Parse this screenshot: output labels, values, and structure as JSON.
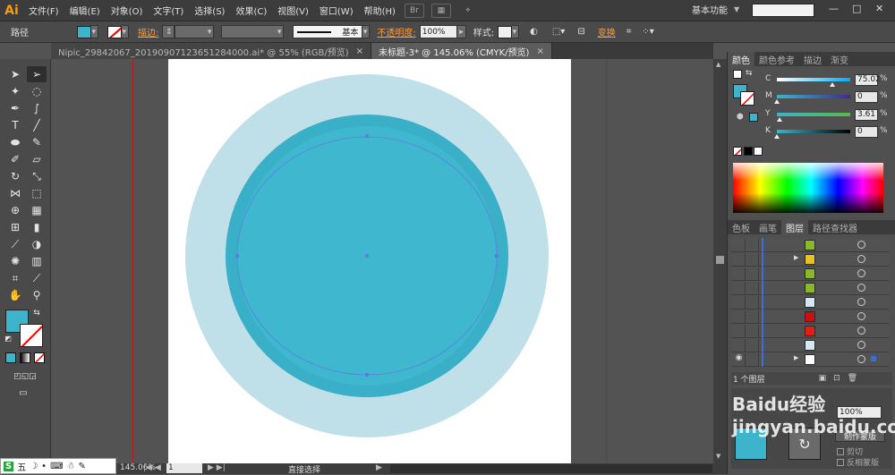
{
  "app": {
    "logo": "Ai",
    "menus": [
      "文件(F)",
      "编辑(E)",
      "对象(O)",
      "文字(T)",
      "选择(S)",
      "效果(C)",
      "视图(V)",
      "窗口(W)",
      "帮助(H)"
    ],
    "bridge_label": "Br",
    "workspace": "基本功能",
    "window_controls": [
      "—",
      "□",
      "✕"
    ]
  },
  "control_bar": {
    "object_label": "路径",
    "fill_color": "#3db4cc",
    "stroke_label": "描边:",
    "stroke_style_label": "基本",
    "opacity_label": "不透明度:",
    "opacity_value": "100%",
    "style_label": "样式:",
    "transform_label": "变换"
  },
  "tabs": [
    {
      "label": "Nipic_29842067_20190907123651284000.ai* @ 55% (RGB/预览)",
      "active": false
    },
    {
      "label": "未标题-3* @ 145.06% (CMYK/预览)",
      "active": true
    }
  ],
  "tools": {
    "fill_color": "#3db4cc"
  },
  "color_panel": {
    "tabs": [
      "颜色",
      "颜色参考",
      "描边",
      "渐变"
    ],
    "channels": [
      {
        "label": "C",
        "value": "75.02",
        "percent": 75.02,
        "track": "linear-gradient(to right,#ffffff,#00aeef)"
      },
      {
        "label": "M",
        "value": "0",
        "percent": 0,
        "track": "linear-gradient(to right,#3db4cc,#3c2e91)"
      },
      {
        "label": "Y",
        "value": "3.61",
        "percent": 3.61,
        "track": "linear-gradient(to right,#3db4cc,#59b847)"
      },
      {
        "label": "K",
        "value": "0",
        "percent": 0,
        "track": "linear-gradient(to right,#3db4cc,#000000)"
      }
    ],
    "percent_sign": "%"
  },
  "layers_panel": {
    "tabs": [
      "色板",
      "画笔",
      "图层",
      "路径查找器"
    ],
    "rows": [
      {
        "thumb": "#8ab82a",
        "expand": false,
        "visible": false,
        "selected": false
      },
      {
        "thumb": "#e8c020",
        "expand": true,
        "visible": false,
        "selected": false
      },
      {
        "thumb": "#8ab82a",
        "expand": false,
        "visible": false,
        "selected": false
      },
      {
        "thumb": "#8ab82a",
        "expand": false,
        "visible": false,
        "selected": false
      },
      {
        "thumb": "#d6e8f0",
        "expand": false,
        "visible": false,
        "selected": false
      },
      {
        "thumb": "#cc1010",
        "expand": false,
        "visible": false,
        "selected": false
      },
      {
        "thumb": "#e02010",
        "expand": false,
        "visible": false,
        "selected": false
      },
      {
        "thumb": "#d6e8f0",
        "expand": false,
        "visible": false,
        "selected": false
      },
      {
        "thumb": "#ffffff",
        "expand": true,
        "visible": true,
        "selected": true
      }
    ],
    "footer_text": "1 个图层"
  },
  "transparency_panel": {
    "opacity_value": "100%",
    "make_mask_label": "制作蒙版",
    "clip_label": "剪切",
    "invert_mask_label": "反相蒙版"
  },
  "canvas": {
    "outer_circle_color": "#bfe0e9",
    "middle_circle_color": "#3aafc8",
    "inner_circle_color": "#3fb8cf"
  },
  "status": {
    "zoom": "145.06%",
    "page": "1",
    "tool_name": "直接选择"
  },
  "ime": {
    "items": [
      "S",
      "五",
      "☽",
      "•",
      "⌨",
      "☃",
      "✎"
    ]
  },
  "watermark": "Baidu经验 jingyan.baidu.com"
}
